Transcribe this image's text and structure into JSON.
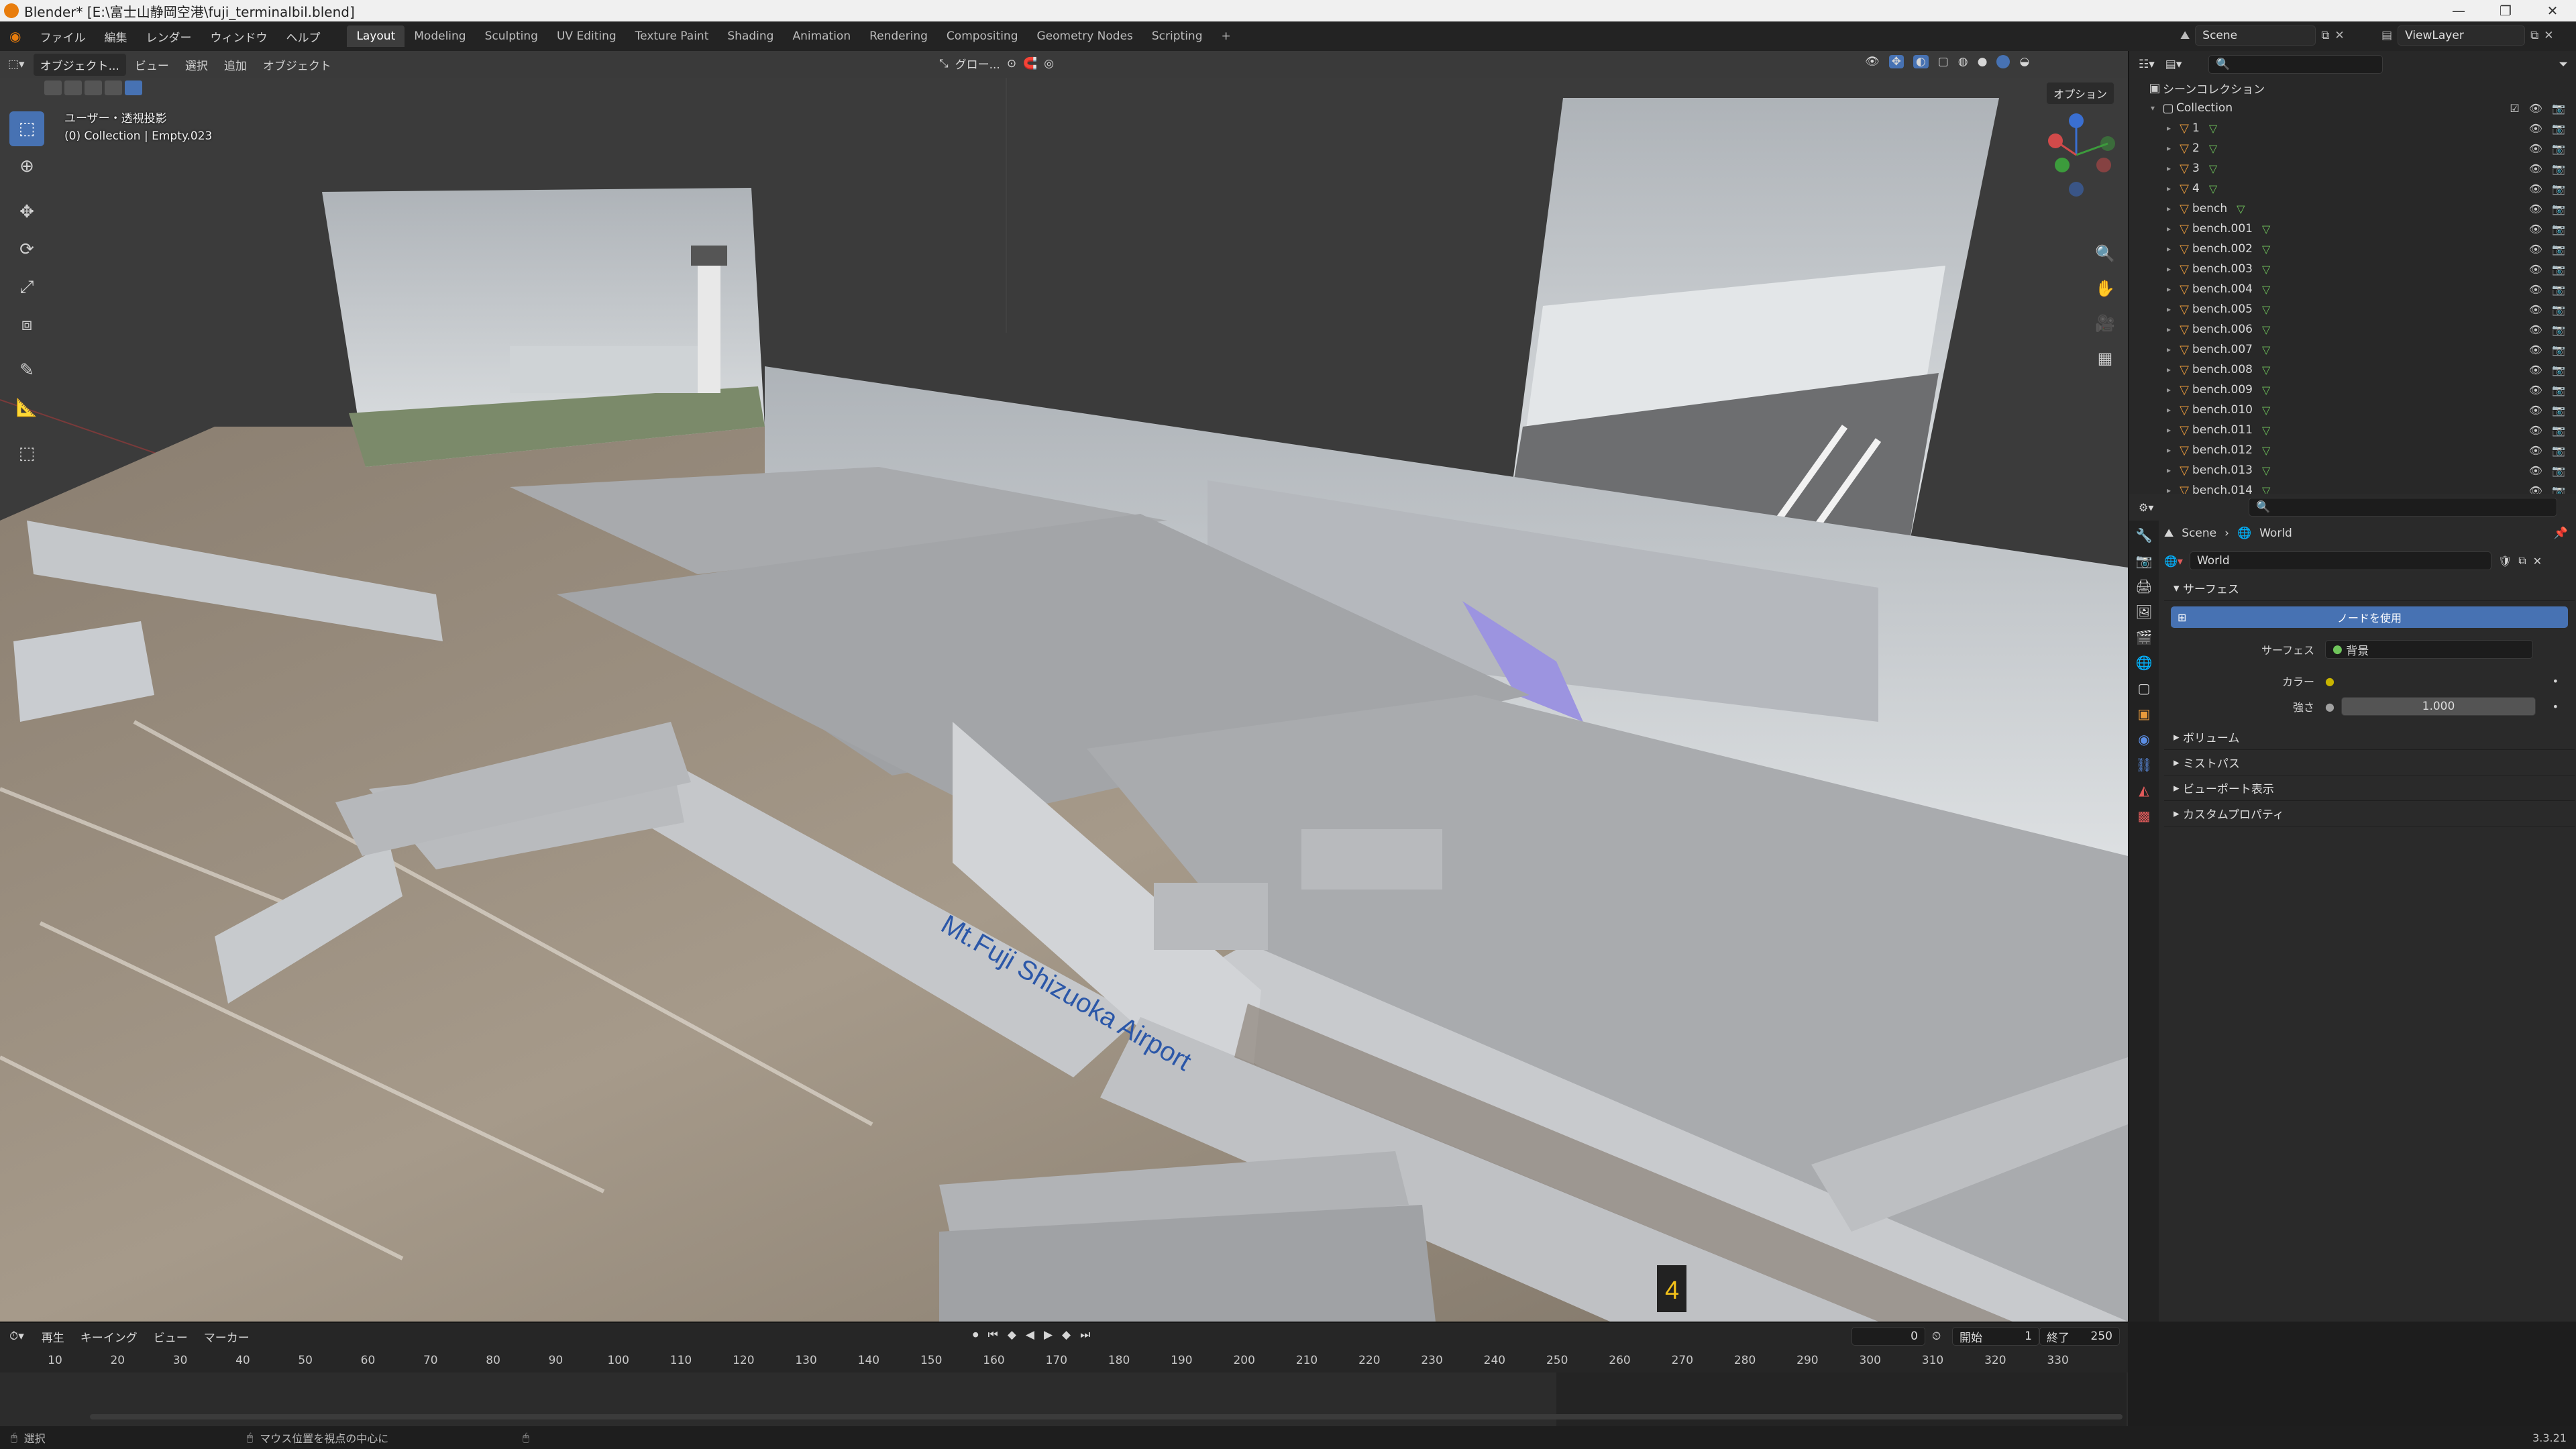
{
  "window": {
    "title": "Blender* [E:\\富士山静岡空港\\fuji_terminalbil.blend]",
    "controls": [
      "—",
      "❐",
      "✕"
    ]
  },
  "menu": {
    "items": [
      "ファイル",
      "編集",
      "レンダー",
      "ウィンドウ",
      "ヘルプ"
    ],
    "workspaces": [
      "Layout",
      "Modeling",
      "Sculpting",
      "UV Editing",
      "Texture Paint",
      "Shading",
      "Animation",
      "Rendering",
      "Compositing",
      "Geometry Nodes",
      "Scripting"
    ],
    "active_workspace": "Layout",
    "add_tab": "+",
    "scene_label": "Scene",
    "viewlayer_label": "ViewLayer"
  },
  "viewport": {
    "mode": "オブジェクト...",
    "header_items": [
      "ビュー",
      "選択",
      "追加",
      "オブジェクト"
    ],
    "transform_orientation": "グロー...",
    "options_label": "オプション",
    "overlay_title": "ユーザー・透視投影",
    "overlay_subtitle": "(0) Collection | Empty.023",
    "sign_text": "Mt.Fuji Shizuoka Airport",
    "gate_number": "4"
  },
  "outliner": {
    "root": "シーンコレクション",
    "collection": "Collection",
    "items": [
      "1",
      "2",
      "3",
      "4",
      "bench",
      "bench.001",
      "bench.002",
      "bench.003",
      "bench.004",
      "bench.005",
      "bench.006",
      "bench.007",
      "bench.008",
      "bench.009",
      "bench.010",
      "bench.011",
      "bench.012",
      "bench.013",
      "bench.014"
    ]
  },
  "properties": {
    "breadcrumb_scene": "Scene",
    "breadcrumb_world": "World",
    "world_name": "World",
    "surface_panel": "サーフェス",
    "use_nodes_button": "ノードを使用",
    "surface_label": "サーフェス",
    "surface_value": "背景",
    "color_label": "カラー",
    "strength_label": "強さ",
    "strength_value": "1.000",
    "collapsed_panels": [
      "ボリューム",
      "ミストパス",
      "ビューポート表示",
      "カスタムプロパティ"
    ]
  },
  "timeline": {
    "menu": [
      "再生",
      "キーイング",
      "ビュー",
      "マーカー"
    ],
    "current_frame": "0",
    "start_label": "開始",
    "start_value": "1",
    "end_label": "終了",
    "end_value": "250",
    "ticks": [
      "10",
      "20",
      "30",
      "40",
      "50",
      "60",
      "70",
      "80",
      "90",
      "100",
      "110",
      "120",
      "130",
      "140",
      "150",
      "160",
      "170",
      "180",
      "190",
      "200",
      "210",
      "220",
      "230",
      "240",
      "250",
      "260",
      "270",
      "280",
      "290",
      "300",
      "310",
      "320",
      "330"
    ]
  },
  "status": {
    "select": "選択",
    "center_view": "マウス位置を視点の中心に",
    "version": "3.3.21"
  }
}
